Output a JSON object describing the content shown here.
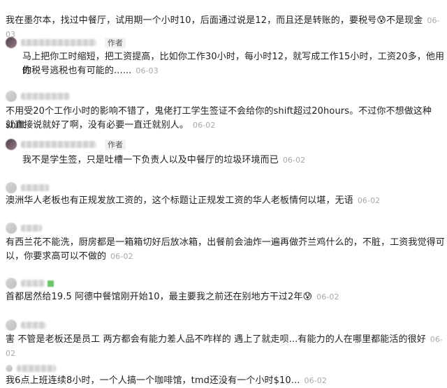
{
  "author_tag": "作者",
  "comments": [
    {
      "lines": [
        "我在墨尔本，找过中餐厅，试用期一个小时10，后面通过说是12，而且还是转账的，要税号",
        "不是现金"
      ],
      "emoji": "😰",
      "date": "06-03"
    },
    {
      "lines": [
        "马上把你工时缩短，把工资提高，比如你工作30小时，每小时12，就写成工作15小时，工资20多，他用你",
        "的税号逃税也有可能的......"
      ],
      "date": "06-03"
    },
    {
      "lines": [
        "不用受20个工作小时的影响不错了，鬼佬打工学生签证不会给你的shift超过20hours。不过你不想做这种shift",
        "就直接说就好了啊，没有必要一直迁就别人。"
      ],
      "date": "06-02"
    },
    {
      "lines": [
        "我不是学生签，只是吐槽一下负责人以及中餐厅的垃圾环境而已"
      ],
      "date": "06-02"
    },
    {
      "lines": [
        "澳洲华人老板也有正规发放工资的，这个标题让正规发工资的华人老板情何以堪，无语"
      ],
      "date": "06-02"
    },
    {
      "lines": [
        "有西兰花不能洗，厨房都是一箱箱切好后放冰箱，出餐前会油炸一遍再做芥兰鸡什么的，不脏，工资我觉得可",
        "以，你要求高可以不做的"
      ],
      "date": "06-02"
    },
    {
      "lines": [
        "首都居然给19.5 阿德中餐馆刚开始10，最主要我之前还在别地方干过2年"
      ],
      "emoji": "😰",
      "date": "06-02"
    },
    {
      "lines": [
        "害 不管是老板还是员工 两方都会有能力差人品不咋样的 遇上了就走呗...有能力的人在哪里都能活的很好"
      ],
      "date": "06-02"
    },
    {
      "lines": [
        "我6点上班连续8小时，一个人搞一个咖啡馆，tmd还没有一个小时$10..."
      ],
      "date": "06-02"
    }
  ]
}
